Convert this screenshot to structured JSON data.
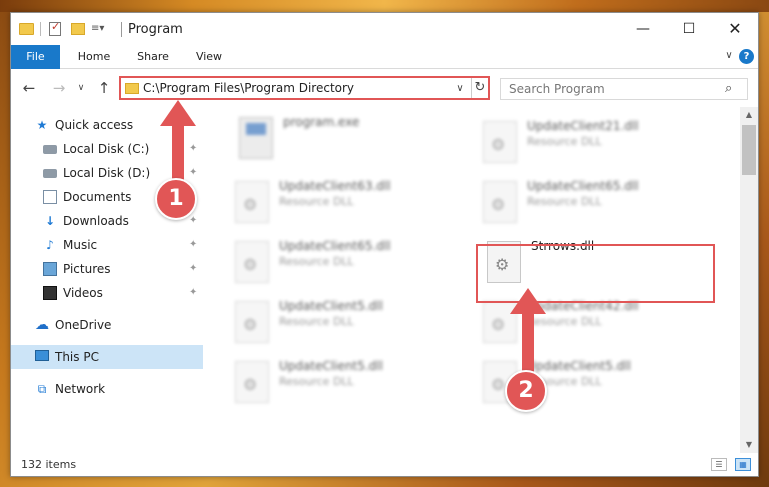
{
  "window": {
    "title": "Program",
    "controls": {
      "minimize": "—",
      "maximize": "☐",
      "close": "✕"
    }
  },
  "quick_access_toolbar": {
    "customize": "≡▾"
  },
  "ribbon": {
    "tabs": [
      {
        "label": "File",
        "active": true
      },
      {
        "label": "Home"
      },
      {
        "label": "Share"
      },
      {
        "label": "View"
      }
    ],
    "expand": "∨",
    "help": "?"
  },
  "navigation": {
    "back": "←",
    "forward": "→",
    "recent": "∨",
    "up": "↑",
    "address": "C:\\Program Files\\Program Directory",
    "address_dropdown": "∨",
    "refresh": "↻",
    "search_placeholder": "Search Program",
    "search_icon": "⌕"
  },
  "sidebar": {
    "pin_glyph": "✦",
    "items": [
      {
        "label": "Quick access",
        "icon": "★"
      },
      {
        "label": "Local Disk (C:)",
        "icon": ""
      },
      {
        "label": "Local Disk (D:)",
        "icon": ""
      },
      {
        "label": "Documents",
        "icon": ""
      },
      {
        "label": "Downloads",
        "icon": "↓"
      },
      {
        "label": "Music",
        "icon": "♪"
      },
      {
        "label": "Pictures",
        "icon": ""
      },
      {
        "label": "Videos",
        "icon": ""
      },
      {
        "label": "OneDrive",
        "icon": "☁"
      },
      {
        "label": "This PC",
        "icon": ""
      },
      {
        "label": "Network",
        "icon": "⧉"
      }
    ]
  },
  "files": [
    {
      "name": "program.exe",
      "type": ""
    },
    {
      "name": "UpdateClient21.dll",
      "type": "Resource DLL"
    },
    {
      "name": "UpdateClient63.dll",
      "type": "Resource DLL"
    },
    {
      "name": "UpdateClient65.dll",
      "type": "Resource DLL"
    },
    {
      "name": "UpdateClient65.dll",
      "type": "Resource DLL"
    },
    {
      "name": "Strrows.dll",
      "type": ""
    },
    {
      "name": "UpdateClient5.dll",
      "type": "Resource DLL"
    },
    {
      "name": "UpdateClient42.dll",
      "type": "Resource DLL"
    },
    {
      "name": "UpdateClient5.dll",
      "type": "Resource DLL"
    },
    {
      "name": "UpdateClient5.dll",
      "type": "Resource DLL"
    }
  ],
  "gear_glyph": "⚙",
  "scrollbar": {
    "up": "▲",
    "down": "▼"
  },
  "status": {
    "item_count": "132 items",
    "view_details": "☰",
    "view_tiles": "▦"
  },
  "annotations": {
    "step1": "1",
    "step2": "2",
    "color": "#e15656"
  }
}
